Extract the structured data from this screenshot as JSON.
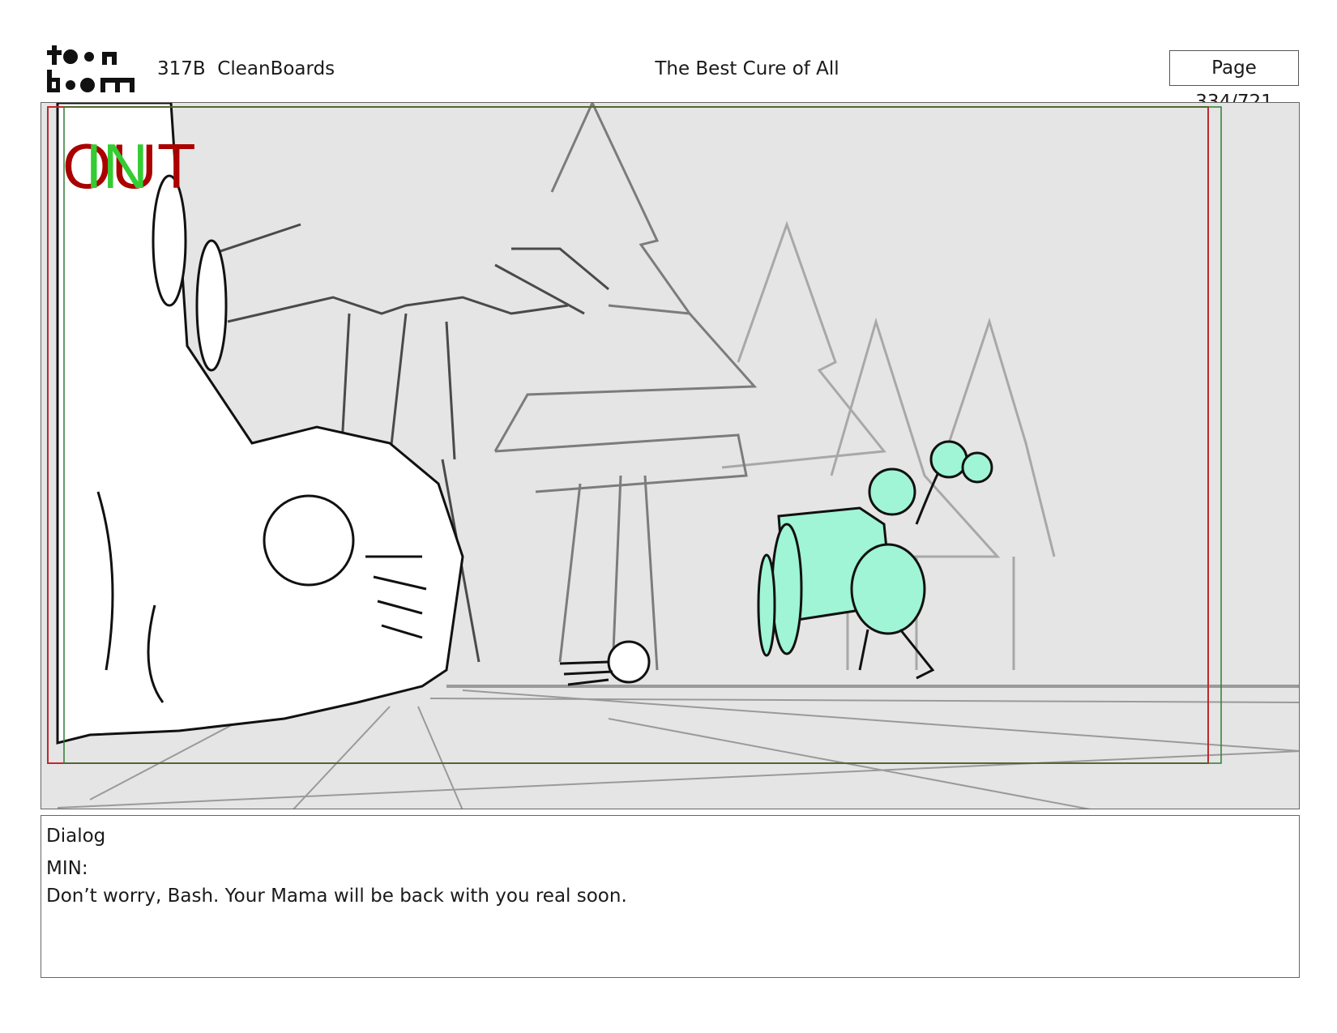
{
  "header": {
    "logo_text": "toon boom",
    "project": "317B  CleanBoards",
    "title": "The Best Cure of All",
    "page": "Page 334/721"
  },
  "panel": {
    "in_label": "IN",
    "out_label": "OUT",
    "colors": {
      "background": "#e5e5e5",
      "safe_frame": "#c0282d",
      "in_frame": "#2e7d32",
      "highlight_character": "#9ff5d5",
      "in_text": "#33cc33",
      "out_text": "#aa0000"
    }
  },
  "dialog": {
    "heading": "Dialog",
    "speaker": "MIN:",
    "line": "Don’t worry, Bash. Your Mama will be back with you real soon."
  }
}
